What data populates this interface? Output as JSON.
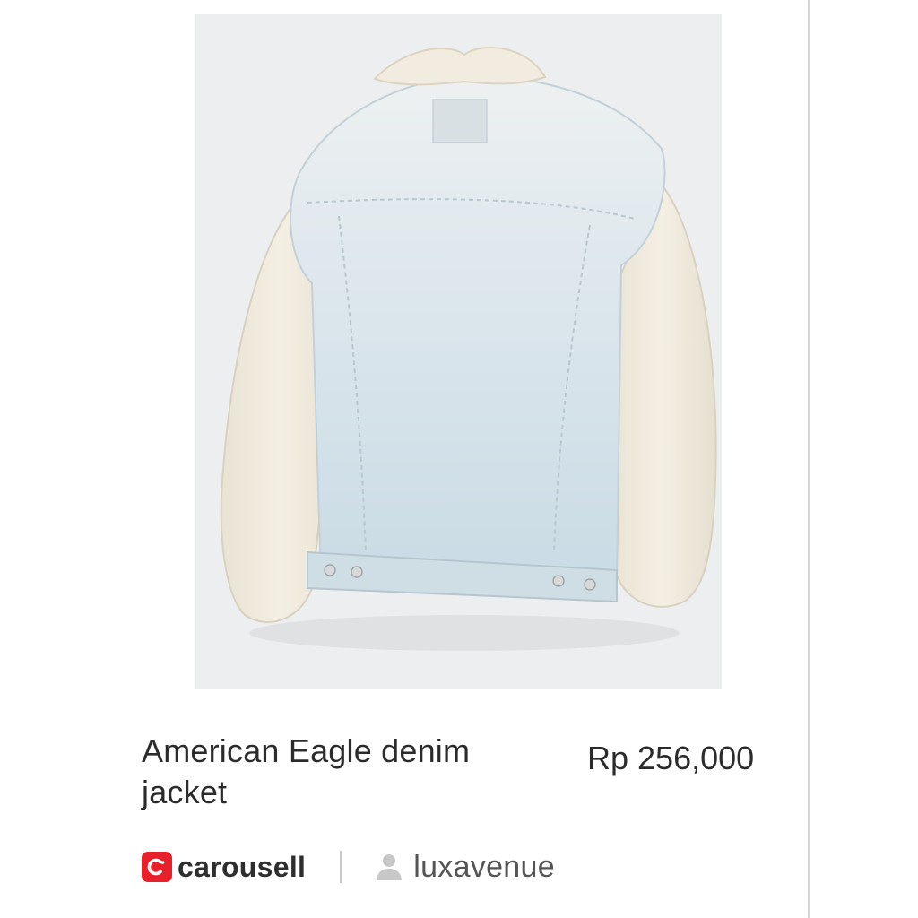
{
  "listing": {
    "image_alt_icon": "product-photo",
    "title": "American Eagle denim jacket",
    "price": "Rp 256,000"
  },
  "brand": {
    "name": "carousell",
    "color": "#e8202a",
    "logo_icon": "carousell-logo-icon"
  },
  "seller": {
    "username": "luxavenue",
    "icon": "user-icon"
  }
}
